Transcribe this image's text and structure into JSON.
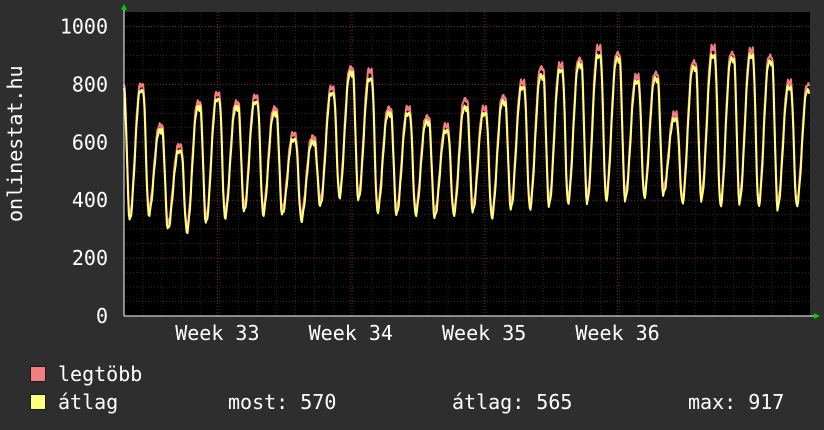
{
  "chart_data": {
    "type": "line",
    "ylabel": "onlinestat.hu",
    "ylim": [
      0,
      1050
    ],
    "y_ticks": [
      "0",
      "200",
      "400",
      "600",
      "800",
      "1000"
    ],
    "x_tick_labels": [
      "Week 33",
      "Week 34",
      "Week 35",
      "Week 36"
    ],
    "grid": true,
    "legend_placement": "bottom-left",
    "series": [
      {
        "name": "legtöbb",
        "color": "#f07f7f",
        "daily_peaks": [
          800,
          660,
          590,
          740,
          770,
          740,
          760,
          720,
          630,
          620,
          790,
          860,
          850,
          720,
          720,
          690,
          660,
          750,
          720,
          760,
          810,
          860,
          870,
          890,
          930,
          910,
          830,
          840,
          700,
          880,
          930,
          910,
          920,
          900,
          810,
          800
        ],
        "daily_troughs": [
          350,
          370,
          320,
          310,
          340,
          360,
          380,
          370,
          370,
          350,
          400,
          430,
          420,
          380,
          370,
          370,
          360,
          370,
          380,
          360,
          390,
          390,
          400,
          410,
          410,
          420,
          420,
          430,
          440,
          410,
          420,
          400,
          410,
          400,
          390,
          400
        ]
      },
      {
        "name": "átlag",
        "color": "#ffff80",
        "daily_peaks": [
          780,
          640,
          570,
          720,
          750,
          720,
          740,
          700,
          610,
          600,
          770,
          840,
          820,
          700,
          700,
          670,
          640,
          720,
          700,
          740,
          790,
          830,
          850,
          870,
          900,
          890,
          810,
          820,
          680,
          860,
          900,
          890,
          900,
          880,
          790,
          780
        ],
        "daily_troughs": [
          330,
          350,
          300,
          290,
          320,
          340,
          360,
          350,
          350,
          330,
          380,
          410,
          400,
          360,
          350,
          350,
          340,
          350,
          360,
          340,
          370,
          370,
          380,
          390,
          390,
          400,
          400,
          410,
          420,
          390,
          400,
          380,
          390,
          380,
          370,
          380
        ]
      }
    ]
  },
  "legend": {
    "max_label": "legtöbb",
    "avg_label": "átlag"
  },
  "stats": {
    "current": "most: 570",
    "average": "átlag: 565",
    "maximum": "max: 917"
  }
}
